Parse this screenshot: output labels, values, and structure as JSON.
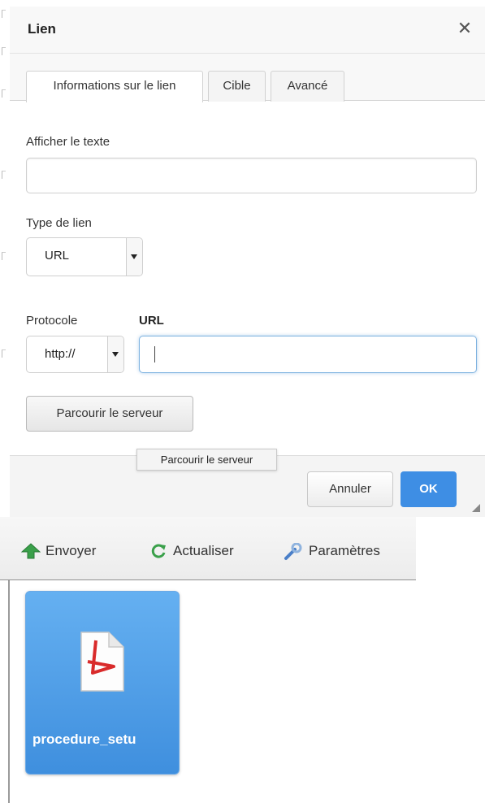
{
  "dialog": {
    "title": "Lien",
    "close_glyph": "✕",
    "tabs": [
      {
        "label": "Informations sur le lien",
        "active": true
      },
      {
        "label": "Cible",
        "active": false
      },
      {
        "label": "Avancé",
        "active": false
      }
    ],
    "display_text": {
      "label": "Afficher le texte",
      "value": ""
    },
    "link_type": {
      "label": "Type de lien",
      "value": "URL"
    },
    "protocol": {
      "label": "Protocole",
      "value": "http://"
    },
    "url": {
      "label": "URL",
      "value": ""
    },
    "browse_button": "Parcourir le serveur",
    "tooltip": "Parcourir le serveur",
    "cancel_button": "Annuler",
    "ok_button": "OK",
    "colors": {
      "ok": "#3e8ee4",
      "focus": "#7fb3e0"
    }
  },
  "file_browser": {
    "toolbar": [
      {
        "label": "Envoyer",
        "icon": "upload-arrow-icon",
        "color": "#3aa04a"
      },
      {
        "label": "Actualiser",
        "icon": "refresh-icon",
        "color": "#3aa04a"
      },
      {
        "label": "Paramètres",
        "icon": "wrench-icon",
        "color": "#4a7fc8"
      }
    ],
    "files": [
      {
        "name": "procedure_setu",
        "icon": "pdf-file-icon",
        "selected": true
      }
    ],
    "colors": {
      "selection": "#4b9be6"
    }
  }
}
